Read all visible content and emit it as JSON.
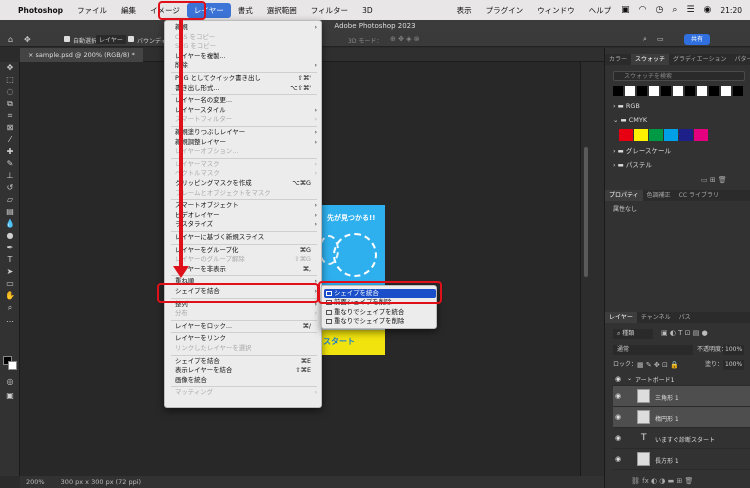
{
  "menubar": {
    "apple": "",
    "app": "Photoshop",
    "items": [
      "ファイル",
      "編集",
      "イメージ",
      "レイヤー",
      "書式",
      "選択範囲",
      "フィルター",
      "3D",
      "表示",
      "プラグイン",
      "ウィンドウ",
      "ヘルプ"
    ],
    "clock": "21:20"
  },
  "titlebar": "Adobe Photoshop 2023",
  "options": {
    "auto_select": "自動選択：",
    "layer": "レイヤー",
    "transform": "バウンディ",
    "mode3d": "3D モード：",
    "share": "共有"
  },
  "doc_tab": "sample.psd @ 200% (RGB/8) *",
  "status": {
    "zoom": "200%",
    "size": "300 px x 300 px (72 ppi)"
  },
  "artwork": {
    "headline": "先が見つかる!!",
    "bottom": "スタート"
  },
  "layer_menu": [
    {
      "label": "新規",
      "shortcut": "",
      "arrow": true,
      "disabled": false
    },
    {
      "label": "CSS をコピー",
      "shortcut": "",
      "arrow": false,
      "disabled": true
    },
    {
      "label": "SVG をコピー",
      "shortcut": "",
      "arrow": false,
      "disabled": true
    },
    {
      "label": "レイヤーを複製...",
      "shortcut": "",
      "arrow": false,
      "disabled": false
    },
    {
      "label": "削除",
      "shortcut": "",
      "arrow": true,
      "disabled": false
    },
    {
      "sep": true
    },
    {
      "label": "PNG としてクイック書き出し",
      "shortcut": "⇧⌘'",
      "arrow": false,
      "disabled": false
    },
    {
      "label": "書き出し形式...",
      "shortcut": "⌥⇧⌘'",
      "arrow": false,
      "disabled": false
    },
    {
      "sep": true
    },
    {
      "label": "レイヤー名の変更...",
      "shortcut": "",
      "arrow": false,
      "disabled": false
    },
    {
      "label": "レイヤースタイル",
      "shortcut": "",
      "arrow": true,
      "disabled": false
    },
    {
      "label": "スマートフィルター",
      "shortcut": "",
      "arrow": true,
      "disabled": true
    },
    {
      "sep": true
    },
    {
      "label": "新規塗りつぶしレイヤー",
      "shortcut": "",
      "arrow": true,
      "disabled": false
    },
    {
      "label": "新規調整レイヤー",
      "shortcut": "",
      "arrow": true,
      "disabled": false
    },
    {
      "label": "レイヤーオプション...",
      "shortcut": "",
      "arrow": false,
      "disabled": true
    },
    {
      "sep": true
    },
    {
      "label": "レイヤーマスク",
      "shortcut": "",
      "arrow": true,
      "disabled": true
    },
    {
      "label": "ベクトルマスク",
      "shortcut": "",
      "arrow": true,
      "disabled": true
    },
    {
      "label": "クリッピングマスクを作成",
      "shortcut": "⌥⌘G",
      "arrow": false,
      "disabled": false
    },
    {
      "label": "フレームとオブジェクトをマスク",
      "shortcut": "",
      "arrow": false,
      "disabled": true
    },
    {
      "sep": true
    },
    {
      "label": "スマートオブジェクト",
      "shortcut": "",
      "arrow": true,
      "disabled": false
    },
    {
      "label": "ビデオレイヤー",
      "shortcut": "",
      "arrow": true,
      "disabled": false
    },
    {
      "label": "ラスタライズ",
      "shortcut": "",
      "arrow": true,
      "disabled": false
    },
    {
      "sep": true
    },
    {
      "label": "レイヤーに基づく新規スライス",
      "shortcut": "",
      "arrow": false,
      "disabled": false
    },
    {
      "sep": true
    },
    {
      "label": "レイヤーをグループ化",
      "shortcut": "⌘G",
      "arrow": false,
      "disabled": false
    },
    {
      "label": "レイヤーのグループ解除",
      "shortcut": "⇧⌘G",
      "arrow": false,
      "disabled": true
    },
    {
      "label": "レイヤーを非表示",
      "shortcut": "⌘,",
      "arrow": false,
      "disabled": false
    },
    {
      "sep": true
    },
    {
      "label": "重ね順",
      "shortcut": "",
      "arrow": true,
      "disabled": false
    },
    {
      "label": "シェイプを結合",
      "shortcut": "",
      "arrow": true,
      "disabled": false,
      "highlight": true
    },
    {
      "sep": true
    },
    {
      "label": "整列",
      "shortcut": "",
      "arrow": true,
      "disabled": false
    },
    {
      "label": "分布",
      "shortcut": "",
      "arrow": true,
      "disabled": true
    },
    {
      "sep": true
    },
    {
      "label": "レイヤーをロック...",
      "shortcut": "⌘/",
      "arrow": false,
      "disabled": false
    },
    {
      "sep": true
    },
    {
      "label": "レイヤーをリンク",
      "shortcut": "",
      "arrow": false,
      "disabled": false
    },
    {
      "label": "リンクしたレイヤーを選択",
      "shortcut": "",
      "arrow": false,
      "disabled": true
    },
    {
      "sep": true
    },
    {
      "label": "シェイプを結合",
      "shortcut": "⌘E",
      "arrow": false,
      "disabled": false
    },
    {
      "label": "表示レイヤーを結合",
      "shortcut": "⇧⌘E",
      "arrow": false,
      "disabled": false
    },
    {
      "label": "画像を統合",
      "shortcut": "",
      "arrow": false,
      "disabled": false
    },
    {
      "sep": true
    },
    {
      "label": "マッティング",
      "shortcut": "",
      "arrow": true,
      "disabled": true
    }
  ],
  "submenu": [
    "シェイプを統合",
    "前面シェイプを削除",
    "重なりでシェイプを統合",
    "重なりでシェイプを削除"
  ],
  "panel": {
    "top_tabs": [
      "カラー",
      "スウォッチ",
      "グラディエーション",
      "パターン"
    ],
    "search": "スウォッチを検索",
    "folders": [
      "RGB",
      "CMYK",
      "グレースケール",
      "パステル"
    ],
    "cmyk_colors": [
      "#e6007e",
      "#fff100",
      "#00a0e9",
      "#009944",
      "#1d2088",
      "#e4007f",
      "#0075c2",
      "#e60012"
    ],
    "prop_tabs": [
      "プロパティ",
      "色調補正",
      "CC ライブラリ"
    ],
    "prop_text": "属性なし",
    "layer_tabs": [
      "レイヤー",
      "チャンネル",
      "パス"
    ],
    "kind": "種類",
    "blend": "通常",
    "opacity_label": "不透明度：",
    "opacity": "100%",
    "lock_label": "ロック：",
    "fill_label": "塗り：",
    "fill": "100%",
    "layers": [
      "アートボード1",
      "三角形 1",
      "楕円形 1",
      "いますぐ診断スタート",
      "長方形 1"
    ]
  }
}
